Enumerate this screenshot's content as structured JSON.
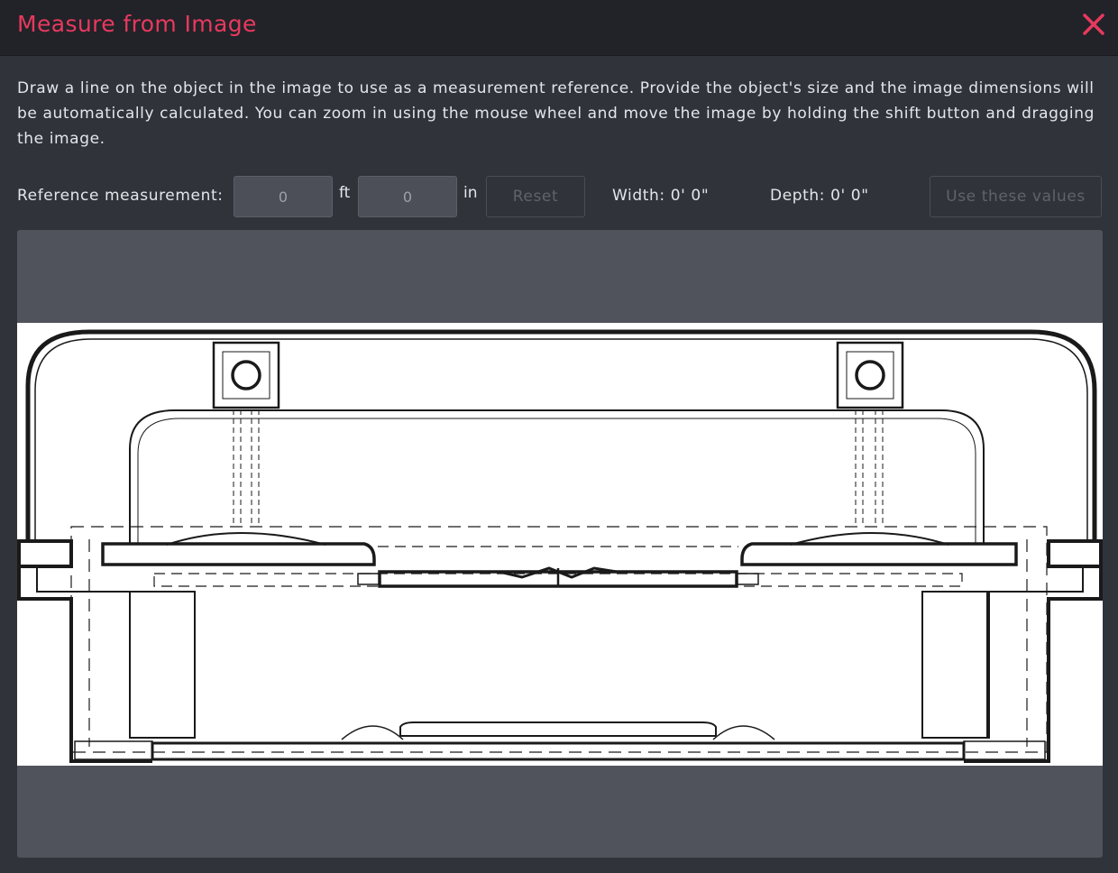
{
  "dialog": {
    "title": "Measure from Image",
    "close_icon": "close-icon",
    "accent_color": "#e8395f"
  },
  "description": "Draw a line on the object in the image to use as a measurement reference. Provide the object's size and the image dimensions will be automatically calculated. You can zoom in using the mouse wheel and move the image by holding the shift button and dragging the image.",
  "reference": {
    "label": "Reference measurement:",
    "feet_value": "0",
    "feet_unit": "ft",
    "inches_value": "0",
    "inches_unit": "in",
    "reset_label": "Reset"
  },
  "dimensions": {
    "width_text": "Width: 0' 0\"",
    "depth_text": "Depth: 0' 0\""
  },
  "actions": {
    "use_values_label": "Use these values"
  }
}
